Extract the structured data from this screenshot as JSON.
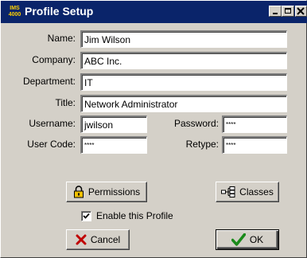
{
  "window": {
    "title": "Profile Setup",
    "app_icon_text": "IMS 4000"
  },
  "form": {
    "name": {
      "label": "Name:",
      "value": "Jim Wilson"
    },
    "company": {
      "label": "Company:",
      "value": "ABC Inc."
    },
    "department": {
      "label": "Department:",
      "value": "IT"
    },
    "title": {
      "label": "Title:",
      "value": "Network Administrator"
    },
    "username": {
      "label": "Username:",
      "value": "jwilson"
    },
    "password": {
      "label": "Password:",
      "value": "****"
    },
    "user_code": {
      "label": "User Code:",
      "value": "****"
    },
    "retype": {
      "label": "Retype:",
      "value": "****"
    }
  },
  "buttons": {
    "permissions": "Permissions",
    "classes": "Classes",
    "cancel": "Cancel",
    "ok": "OK"
  },
  "enable_profile": {
    "label": "Enable this Profile",
    "checked": true
  },
  "colors": {
    "titlebar": "#0a246a",
    "face": "#d4d0c8",
    "cancel_icon": "#c00000",
    "ok_icon": "#1a8a1a"
  },
  "icons": {
    "permissions": "padlock-icon",
    "classes": "hierarchy-icon",
    "cancel": "x-icon",
    "ok": "checkmark-icon"
  }
}
